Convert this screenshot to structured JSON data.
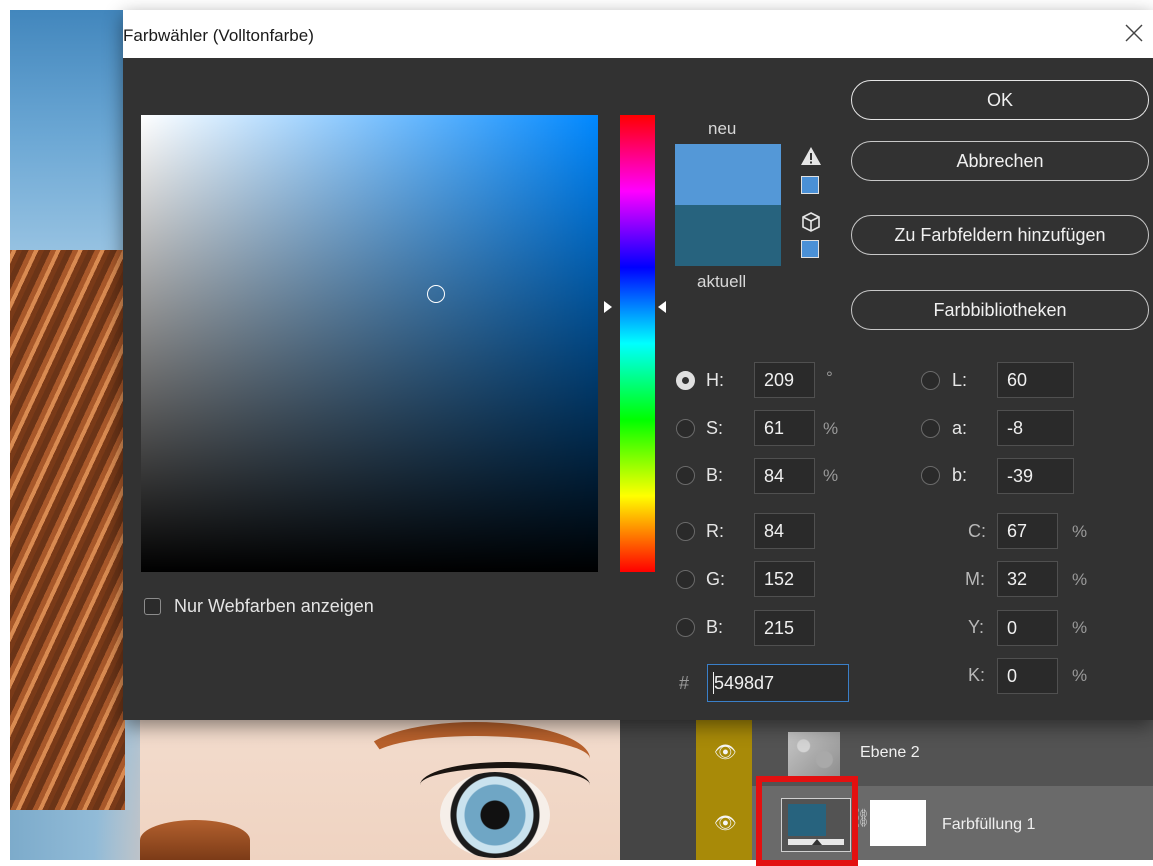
{
  "dialog": {
    "title": "Farbwähler (Volltonfarbe)",
    "close_label": "✕",
    "label_new": "neu",
    "label_current": "aktuell",
    "new_color": "#5498d7",
    "current_color": "#27637e",
    "web_colors_label": "Nur Webfarben anzeigen",
    "web_colors_checked": false
  },
  "buttons": {
    "ok": "OK",
    "cancel": "Abbrechen",
    "add_to_swatches": "Zu Farbfeldern hinzufügen",
    "color_libraries": "Farbbibliotheken"
  },
  "hsb": {
    "h_label": "H:",
    "h_value": "209",
    "h_unit": "°",
    "s_label": "S:",
    "s_value": "61",
    "s_unit": "%",
    "b_label": "B:",
    "b_value": "84",
    "b_unit": "%",
    "selected": "H"
  },
  "rgb": {
    "r_label": "R:",
    "r_value": "84",
    "g_label": "G:",
    "g_value": "152",
    "b_label": "B:",
    "b_value": "215"
  },
  "lab": {
    "l_label": "L:",
    "l_value": "60",
    "a_label": "a:",
    "a_value": "-8",
    "b_label": "b:",
    "b_value": "-39"
  },
  "cmyk": {
    "c_label": "C:",
    "c_value": "67",
    "c_unit": "%",
    "m_label": "M:",
    "m_value": "32",
    "m_unit": "%",
    "y_label": "Y:",
    "y_value": "0",
    "y_unit": "%",
    "k_label": "K:",
    "k_value": "0",
    "k_unit": "%"
  },
  "hex": {
    "prefix": "#",
    "value": "5498d7"
  },
  "layers": {
    "layer_1_name": "Ebene 2",
    "layer_2_name": "Farbfüllung 1",
    "fill_color": "#27637e"
  }
}
